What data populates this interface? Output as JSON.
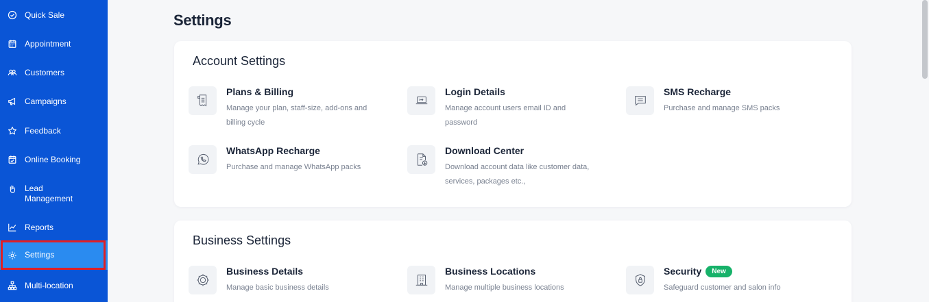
{
  "sidebar": {
    "items": [
      {
        "label": "Quick Sale",
        "icon": "check-circle-icon"
      },
      {
        "label": "Appointment",
        "icon": "calendar-icon"
      },
      {
        "label": "Customers",
        "icon": "users-icon"
      },
      {
        "label": "Campaigns",
        "icon": "megaphone-icon"
      },
      {
        "label": "Feedback",
        "icon": "star-icon"
      },
      {
        "label": "Online Booking",
        "icon": "calendar-check-icon"
      },
      {
        "label": "Lead Management",
        "icon": "hand-icon"
      },
      {
        "label": "Reports",
        "icon": "chart-line-icon"
      },
      {
        "label": "Settings",
        "icon": "gear-icon",
        "active": true
      },
      {
        "label": "Multi-location",
        "icon": "sitemap-icon"
      }
    ]
  },
  "page": {
    "title": "Settings"
  },
  "account_settings": {
    "title": "Account Settings",
    "items": [
      {
        "title": "Plans & Billing",
        "desc": "Manage your plan, staff-size, add-ons and billing cycle",
        "icon": "receipt-icon"
      },
      {
        "title": "Login Details",
        "desc": "Manage account users email ID and password",
        "icon": "login-laptop-icon"
      },
      {
        "title": "SMS Recharge",
        "desc": "Purchase and manage SMS packs",
        "icon": "message-icon"
      },
      {
        "title": "WhatsApp Recharge",
        "desc": "Purchase and manage WhatsApp packs",
        "icon": "whatsapp-icon"
      },
      {
        "title": "Download Center",
        "desc": "Download account data like customer data, services, packages etc.,",
        "icon": "file-download-icon"
      }
    ]
  },
  "business_settings": {
    "title": "Business Settings",
    "items": [
      {
        "title": "Business Details",
        "desc": "Manage basic business details",
        "icon": "business-gear-icon"
      },
      {
        "title": "Business Locations",
        "desc": "Manage multiple business locations",
        "icon": "building-icon"
      },
      {
        "title": "Security",
        "desc": "Safeguard customer and salon info",
        "icon": "shield-lock-icon",
        "badge": "New"
      }
    ]
  },
  "colors": {
    "sidebar": "#0a55d6",
    "active": "#2a8bf0",
    "highlight": "#e01f24",
    "badge": "#17b26a"
  }
}
